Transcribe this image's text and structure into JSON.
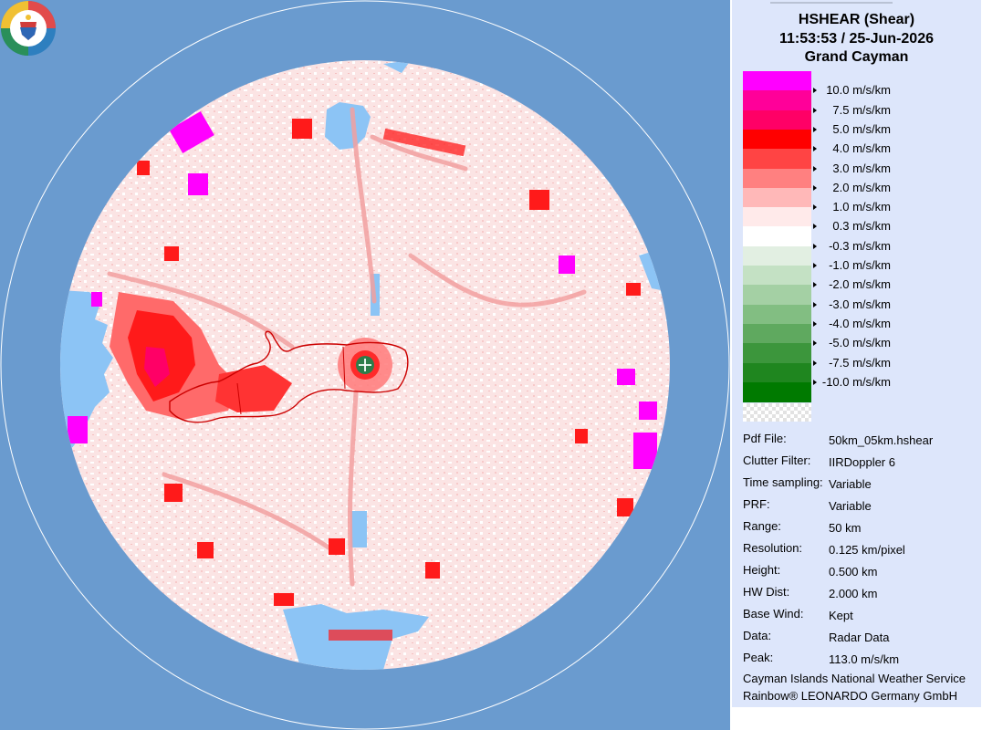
{
  "header": {
    "product": "HSHEAR (Shear)",
    "datetime": "11:53:53 / 25-Jun-2026",
    "site": "Grand Cayman"
  },
  "legend": {
    "levels": [
      {
        "label": "10.0 m/s/km",
        "color": "#ff00ff"
      },
      {
        "label": "7.5 m/s/km",
        "color": "#ff0099"
      },
      {
        "label": "5.0 m/s/km",
        "color": "#ff0066"
      },
      {
        "label": "4.0 m/s/km",
        "color": "#ff0000"
      },
      {
        "label": "3.0 m/s/km",
        "color": "#ff4444"
      },
      {
        "label": "2.0 m/s/km",
        "color": "#ff8080"
      },
      {
        "label": "1.0 m/s/km",
        "color": "#ffb8b8"
      },
      {
        "label": "0.3 m/s/km",
        "color": "#ffeaea"
      },
      {
        "label": "-0.3 m/s/km",
        "color": "#ffffff"
      },
      {
        "label": "-1.0 m/s/km",
        "color": "#e2efe2"
      },
      {
        "label": "-2.0 m/s/km",
        "color": "#c4e1c4"
      },
      {
        "label": "-3.0 m/s/km",
        "color": "#a4d0a4"
      },
      {
        "label": "-4.0 m/s/km",
        "color": "#82be82"
      },
      {
        "label": "-5.0 m/s/km",
        "color": "#5fa95f"
      },
      {
        "label": "-7.5 m/s/km",
        "color": "#3c963c"
      },
      {
        "label": "-10.0 m/s/km",
        "color": "#1f861f"
      }
    ],
    "last_color": "#007a00"
  },
  "info": [
    {
      "label": "Pdf File:",
      "value": "50km_05km.hshear"
    },
    {
      "label": "Clutter Filter:",
      "value": "IIRDoppler 6"
    },
    {
      "label": "Time sampling:",
      "value": "Variable"
    },
    {
      "label": "PRF:",
      "value": "Variable"
    },
    {
      "label": "Range:",
      "value": "50 km"
    },
    {
      "label": "Resolution:",
      "value": "0.125 km/pixel"
    },
    {
      "label": "Height:",
      "value": "0.500 km"
    },
    {
      "label": "HW Dist:",
      "value": "2.000 km"
    },
    {
      "label": "Base Wind:",
      "value": "Kept"
    },
    {
      "label": "Data:",
      "value": "Radar Data"
    },
    {
      "label": "Peak:",
      "value": "113.0 m/s/km"
    }
  ],
  "credits": {
    "line1": "Cayman Islands National Weather Service",
    "line2": "Rainbow® LEONARDO Germany GmbH"
  },
  "colors": {
    "background_ocean": "#6a9bcf",
    "radar_disc": "#fbe3e3",
    "clutter_blue": "#8cc4f5",
    "coast_line": "#cc0000",
    "site_marker": "#2e7d4a",
    "panel_bg": "#dde6fb"
  }
}
